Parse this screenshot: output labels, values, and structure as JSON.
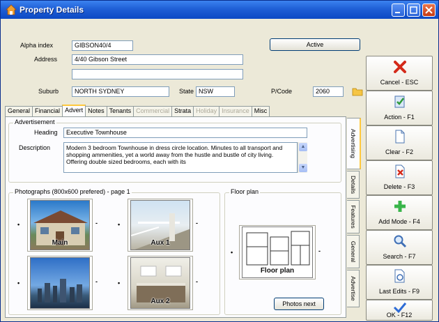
{
  "window": {
    "title": "Property Details"
  },
  "header": {
    "alpha_index_label": "Alpha index",
    "alpha_index_value": "GIBSON40/4",
    "active_label": "Active",
    "address_label": "Address",
    "address_line1": "4/40 Gibson Street",
    "address_line2": "",
    "suburb_label": "Suburb",
    "suburb_value": "NORTH SYDNEY",
    "state_label": "State",
    "state_value": "NSW",
    "postcode_label": "P/Code",
    "postcode_value": "2060"
  },
  "tabs": [
    {
      "label": "General"
    },
    {
      "label": "Financial"
    },
    {
      "label": "Advert"
    },
    {
      "label": "Notes"
    },
    {
      "label": "Tenants"
    },
    {
      "label": "Commercial"
    },
    {
      "label": "Strata"
    },
    {
      "label": "Holiday"
    },
    {
      "label": "Insurance"
    },
    {
      "label": "Misc"
    }
  ],
  "advertisement": {
    "group_title": "Advertisement",
    "heading_label": "Heading",
    "heading_value": "Executive Townhouse",
    "description_label": "Description",
    "description_value": "Modern 3 bedroom Townhouse in dress circle location. Minutes to all transport and shopping ammenities, yet a world away from the hustle and bustle of city living. Offering double sized bedrooms, each with its"
  },
  "photographs": {
    "group_title": "Photographs (800x600 prefered) - page 1",
    "items": [
      {
        "caption": "Main"
      },
      {
        "caption": "Aux 1"
      },
      {
        "caption": ""
      },
      {
        "caption": "Aux 2"
      }
    ],
    "bullet": "•",
    "dash": "-"
  },
  "floorplan": {
    "group_title": "Floor plan",
    "caption": "Floor plan",
    "photos_next": "Photos next"
  },
  "side_tabs": [
    {
      "label": "Advertising"
    },
    {
      "label": "Details"
    },
    {
      "label": "Features"
    },
    {
      "label": "General"
    },
    {
      "label": "Advertise"
    }
  ],
  "actions": [
    {
      "label": "Cancel - ESC",
      "icon": "cancel-x-icon"
    },
    {
      "label": "Action - F1",
      "icon": "action-icon"
    },
    {
      "label": "Clear - F2",
      "icon": "clear-page-icon"
    },
    {
      "label": "Delete - F3",
      "icon": "delete-icon"
    },
    {
      "label": "Add Mode - F4",
      "icon": "add-plus-icon"
    },
    {
      "label": "Search - F7",
      "icon": "search-icon"
    },
    {
      "label": "Last Edits - F9",
      "icon": "last-edits-icon"
    },
    {
      "label": "OK - F12",
      "icon": "ok-check-icon"
    }
  ],
  "colors": {
    "titlebar": "#1f5fd6",
    "cancel_red": "#d42a1a",
    "add_green": "#39b54a",
    "ok_blue": "#2d6bd6"
  }
}
